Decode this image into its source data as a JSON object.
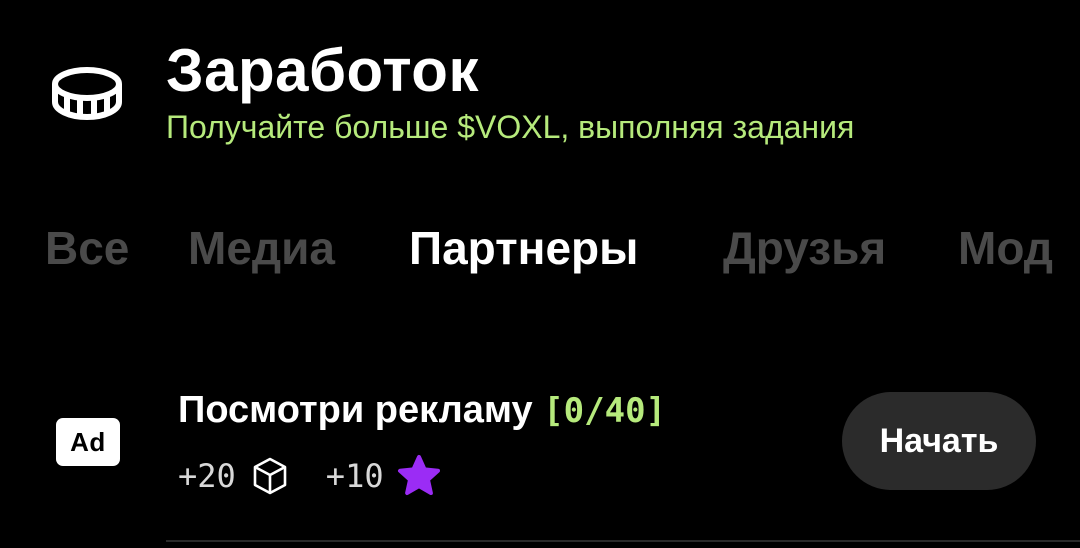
{
  "header": {
    "icon": "coin-icon",
    "title": "Заработок",
    "subtitle": "Получайте больше $VOXL, выполняя задания"
  },
  "tabs": [
    {
      "label": "Все",
      "active": false
    },
    {
      "label": "Медиа",
      "active": false
    },
    {
      "label": "Партнеры",
      "active": true
    },
    {
      "label": "Друзья",
      "active": false
    },
    {
      "label": "Мод",
      "active": false
    }
  ],
  "task": {
    "icon_label": "Ad",
    "title": "Посмотри рекламу ",
    "progress": "[0/40]",
    "rewards": [
      {
        "value": "+20",
        "icon": "cube-icon"
      },
      {
        "value": "+10",
        "icon": "star-icon"
      }
    ],
    "button_label": "Начать"
  },
  "colors": {
    "background": "#000000",
    "accent_green": "#b6ea7c",
    "tab_inactive": "#4a4a4a",
    "button_bg": "#2b2b2b",
    "star_purple": "#9b2cf5"
  }
}
